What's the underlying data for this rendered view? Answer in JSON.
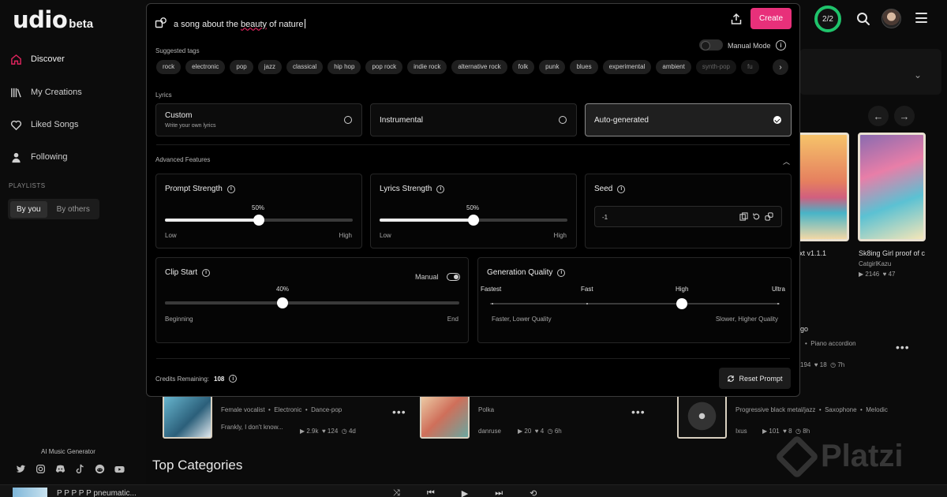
{
  "brand": {
    "name": "udio",
    "tag": "beta"
  },
  "sidebar": {
    "items": [
      {
        "label": "Discover",
        "icon": "home-icon"
      },
      {
        "label": "My Creations",
        "icon": "library-icon"
      },
      {
        "label": "Liked Songs",
        "icon": "heart-icon"
      },
      {
        "label": "Following",
        "icon": "person-icon"
      }
    ],
    "playlists_label": "PLAYLISTS",
    "segments": [
      "By you",
      "By others"
    ],
    "ai_label": "AI Music Generator",
    "socials": [
      "twitter-icon",
      "instagram-icon",
      "discord-icon",
      "tiktok-icon",
      "reddit-icon",
      "youtube-icon"
    ]
  },
  "header": {
    "credits_ring": "2/2"
  },
  "modal": {
    "prompt": {
      "before": "a song about the ",
      "underlined": "beauty",
      "after": " of nature"
    },
    "create_label": "Create",
    "suggested_tags_label": "Suggested tags",
    "manual_mode_label": "Manual Mode",
    "tags": [
      "rock",
      "electronic",
      "pop",
      "jazz",
      "classical",
      "hip hop",
      "pop rock",
      "indie rock",
      "alternative rock",
      "folk",
      "punk",
      "blues",
      "experimental",
      "ambient",
      "synth-pop",
      "fu"
    ],
    "lyrics_label": "Lyrics",
    "lyrics_options": [
      {
        "title": "Custom",
        "subtitle": "Write your own lyrics",
        "selected": false
      },
      {
        "title": "Instrumental",
        "subtitle": "",
        "selected": false
      },
      {
        "title": "Auto-generated",
        "subtitle": "",
        "selected": true
      }
    ],
    "advanced_label": "Advanced Features",
    "prompt_strength": {
      "title": "Prompt Strength",
      "value": 0.5,
      "value_label": "50%",
      "low": "Low",
      "high": "High"
    },
    "lyrics_strength": {
      "title": "Lyrics Strength",
      "value": 0.5,
      "value_label": "50%",
      "low": "Low",
      "high": "High"
    },
    "seed": {
      "title": "Seed",
      "value": "-1"
    },
    "clip_start": {
      "title": "Clip Start",
      "manual_label": "Manual",
      "value": 0.4,
      "value_label": "40%",
      "low": "Beginning",
      "high": "End"
    },
    "generation_quality": {
      "title": "Generation Quality",
      "levels": [
        "Fastest",
        "Fast",
        "High",
        "Ultra"
      ],
      "selected_index": 2,
      "low": "Faster, Lower Quality",
      "high": "Slower, Higher Quality"
    },
    "credits_label": "Credits Remaining:",
    "credits_value": "108",
    "reset_label": "Reset Prompt"
  },
  "background": {
    "card_right_1": {
      "title": "xt v1.1.1"
    },
    "card_right_2": {
      "title": "Sk8ing Girl proof of c",
      "author": "CatgirlKazu",
      "plays": "2146",
      "likes": "47"
    },
    "row_right": {
      "title": "go",
      "tag": "Piano accordion",
      "plays": "194",
      "likes": "18",
      "age": "7h"
    },
    "track1": {
      "tags": [
        "Female vocalist",
        "Electronic",
        "Dance-pop"
      ],
      "lyric": "Frankly, I don't know...",
      "plays": "2.9k",
      "likes": "124",
      "age": "4d"
    },
    "track2": {
      "tags": [
        "Polka"
      ],
      "author": "danruse",
      "plays": "20",
      "likes": "4",
      "age": "6h"
    },
    "track3": {
      "tags": [
        "Progressive black metal/jazz",
        "Saxophone",
        "Melodic"
      ],
      "author": "Ixus",
      "plays": "101",
      "likes": "8",
      "age": "8h"
    },
    "section_title": "Top Categories",
    "player_title": "P P P P P pneumatic... ",
    "watermark": "Platzi"
  }
}
